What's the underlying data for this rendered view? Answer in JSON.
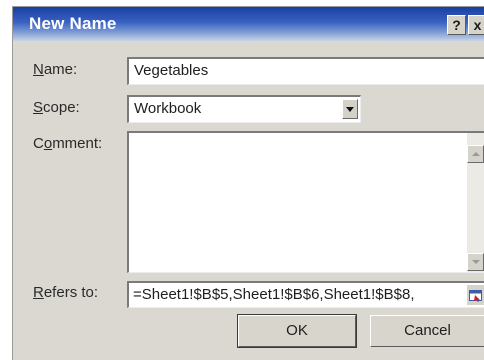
{
  "window": {
    "title": "New Name",
    "help_label": "?",
    "close_label": "x"
  },
  "fields": {
    "name_label_key": "N",
    "name_label_rest": "ame:",
    "name_value": "Vegetables",
    "scope_label_key": "S",
    "scope_label_rest": "cope:",
    "scope_value": "Workbook",
    "comment_label_pre": "C",
    "comment_label_key": "o",
    "comment_label_rest": "mment:",
    "comment_value": "",
    "refers_label_key": "R",
    "refers_label_rest": "efers to:",
    "refers_value": "=Sheet1!$B$5,Sheet1!$B$6,Sheet1!$B$8,"
  },
  "buttons": {
    "ok_label": "OK",
    "cancel_label": "Cancel"
  },
  "colors": {
    "title_bar": "#1a3fa2",
    "dialog_face": "#dad8d0"
  }
}
